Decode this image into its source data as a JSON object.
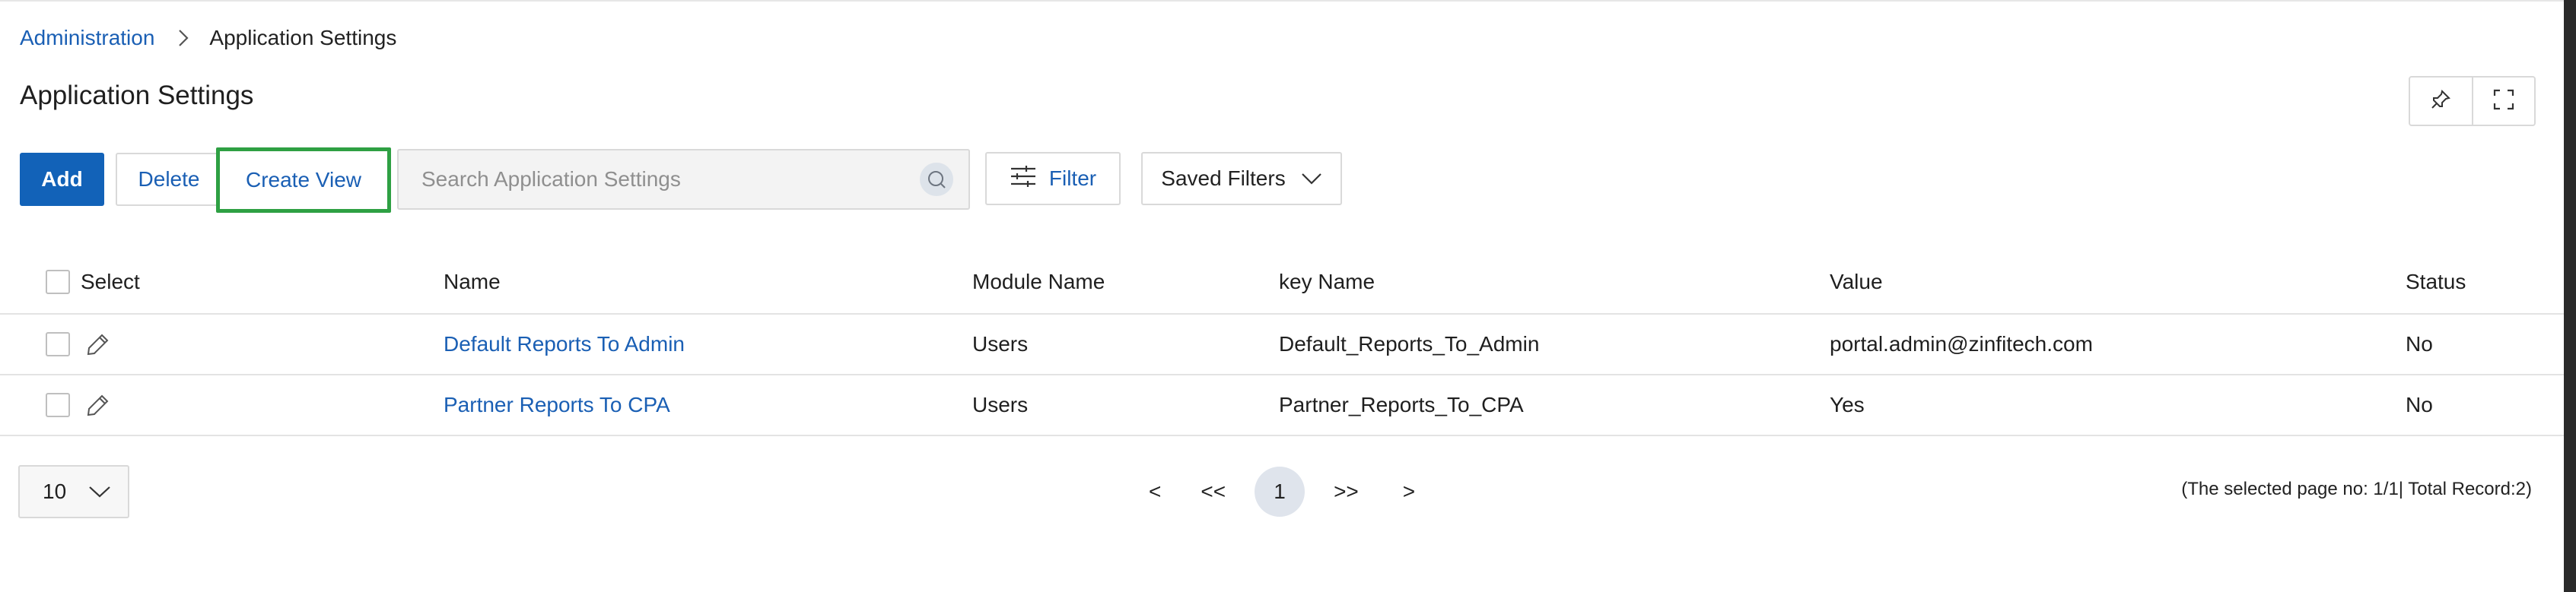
{
  "breadcrumb": {
    "parent": "Administration",
    "current": "Application Settings"
  },
  "page_title": "Application Settings",
  "toolbar": {
    "add_label": "Add",
    "delete_label": "Delete",
    "create_view_label": "Create View",
    "search_placeholder": "Search Application Settings",
    "filter_label": "Filter",
    "saved_filters_label": "Saved Filters"
  },
  "table": {
    "headers": {
      "select": "Select",
      "name": "Name",
      "module": "Module Name",
      "key": "key Name",
      "value": "Value",
      "status": "Status"
    },
    "rows": [
      {
        "name": "Default Reports To Admin",
        "module": "Users",
        "key": "Default_Reports_To_Admin",
        "value": "portal.admin@zinfitech.com",
        "status": "No"
      },
      {
        "name": "Partner Reports To CPA",
        "module": "Users",
        "key": "Partner_Reports_To_CPA",
        "value": "Yes",
        "status": "No"
      }
    ]
  },
  "pagination": {
    "page_size": "10",
    "prev": "<",
    "first": "<<",
    "current_page": "1",
    "last": ">>",
    "next": ">",
    "info": "(The selected page no: 1/1| Total Record:2)"
  },
  "colors": {
    "primary": "#1262b8",
    "link": "#1a5fb4",
    "highlight": "#2ea043",
    "border": "#d9d9d9"
  },
  "icons": [
    "chevron-right-icon",
    "pin-icon",
    "fullscreen-icon",
    "search-icon",
    "sliders-icon",
    "chevron-down-icon",
    "pencil-icon"
  ]
}
